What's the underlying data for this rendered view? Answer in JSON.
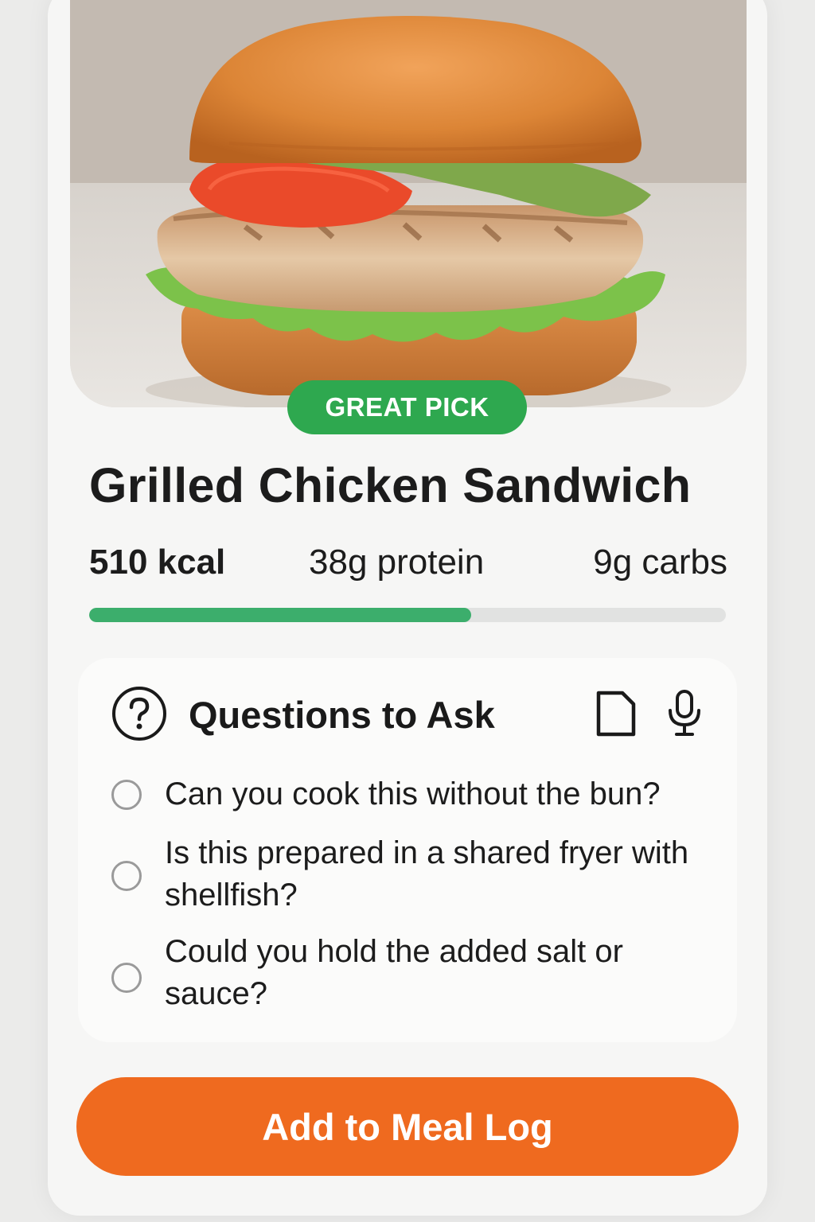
{
  "hero": {
    "image": "grilled-chicken-sandwich-photo",
    "badge": "GREAT PICK",
    "badge_color": "#2ea84f"
  },
  "item": {
    "title": "Grilled Chicken Sandwich",
    "calories": "510 kcal",
    "protein": "38g protein",
    "carbs": "9g carbs",
    "progress_fraction": 0.6,
    "progress_color": "#3cae6c"
  },
  "questions": {
    "icon": "question-circle-icon",
    "title": "Questions to Ask",
    "actions": [
      "document-icon",
      "microphone-icon"
    ],
    "items": [
      {
        "text": "Can you cook this without the bun?",
        "checked": false
      },
      {
        "text": "Is this prepared in a shared fryer with shellfish?",
        "checked": false
      },
      {
        "text": "Could you hold the added salt or sauce?",
        "checked": false
      }
    ]
  },
  "cta": {
    "label": "Add to Meal Log",
    "color": "#ef6a1f"
  }
}
